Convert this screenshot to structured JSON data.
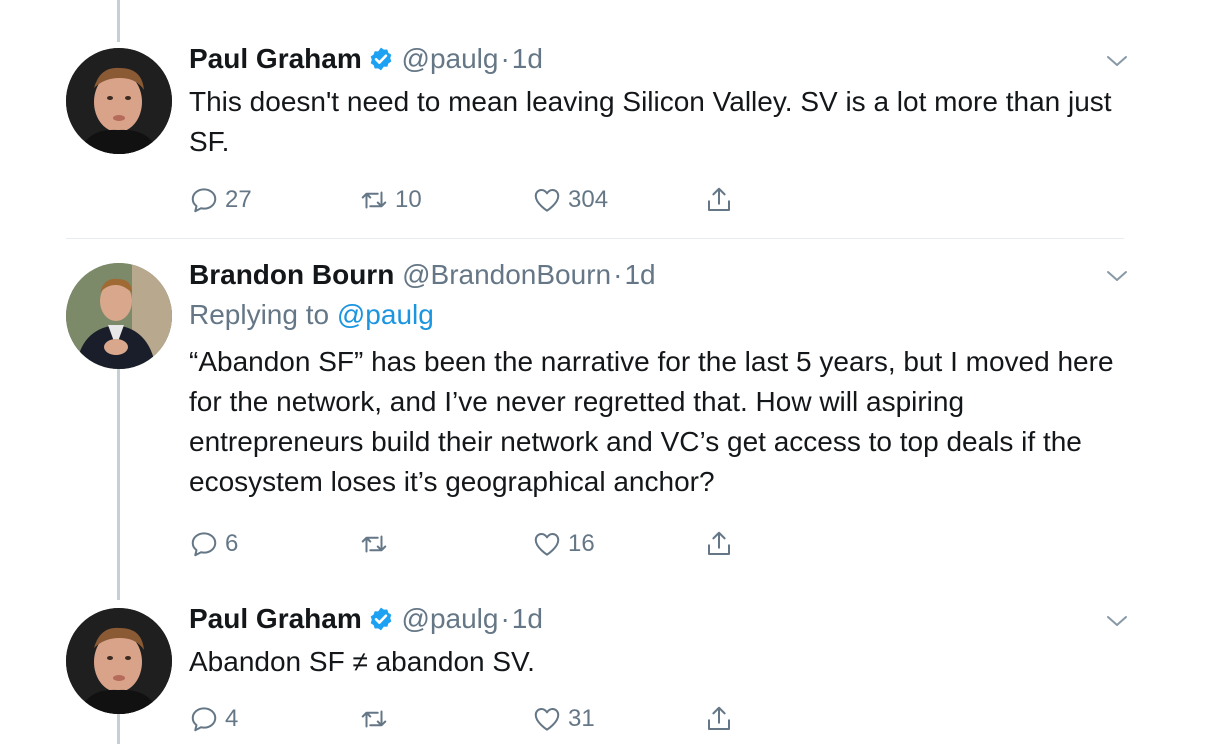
{
  "tweets": [
    {
      "author": "Paul Graham",
      "verified": true,
      "handle": "@paulg",
      "separator": "·",
      "time": "1d",
      "replying_label": "",
      "replying_to": "",
      "text": "This doesn't need to mean leaving Silicon Valley. SV is a lot more than just SF.",
      "replies": "27",
      "retweets": "10",
      "likes": "304"
    },
    {
      "author": "Brandon Bourn",
      "verified": false,
      "handle": "@BrandonBourn",
      "separator": "·",
      "time": "1d",
      "replying_label": "Replying to",
      "replying_to": "@paulg",
      "text": "“Abandon SF” has been the narrative for the last 5 years, but I moved here for the network, and I’ve never regretted that.  How will aspiring entrepreneurs build their network and VC’s get access to top deals if the ecosystem loses it’s geographical anchor?",
      "replies": "6",
      "retweets": "",
      "likes": "16"
    },
    {
      "author": "Paul Graham",
      "verified": true,
      "handle": "@paulg",
      "separator": "·",
      "time": "1d",
      "replying_label": "",
      "replying_to": "",
      "text": "Abandon SF ≠ abandon SV.",
      "replies": "4",
      "retweets": "",
      "likes": "31"
    }
  ],
  "icons": {
    "reply": "reply-icon",
    "retweet": "retweet-icon",
    "like": "heart-icon",
    "share": "share-icon",
    "verified": "verified-badge-icon",
    "more": "chevron-down-icon"
  },
  "colors": {
    "text": "#14171a",
    "secondary": "#657786",
    "link": "#1b95e0",
    "verified": "#1da1f2",
    "thread_line": "#c4cfd6",
    "divider": "#e6ecf0"
  }
}
